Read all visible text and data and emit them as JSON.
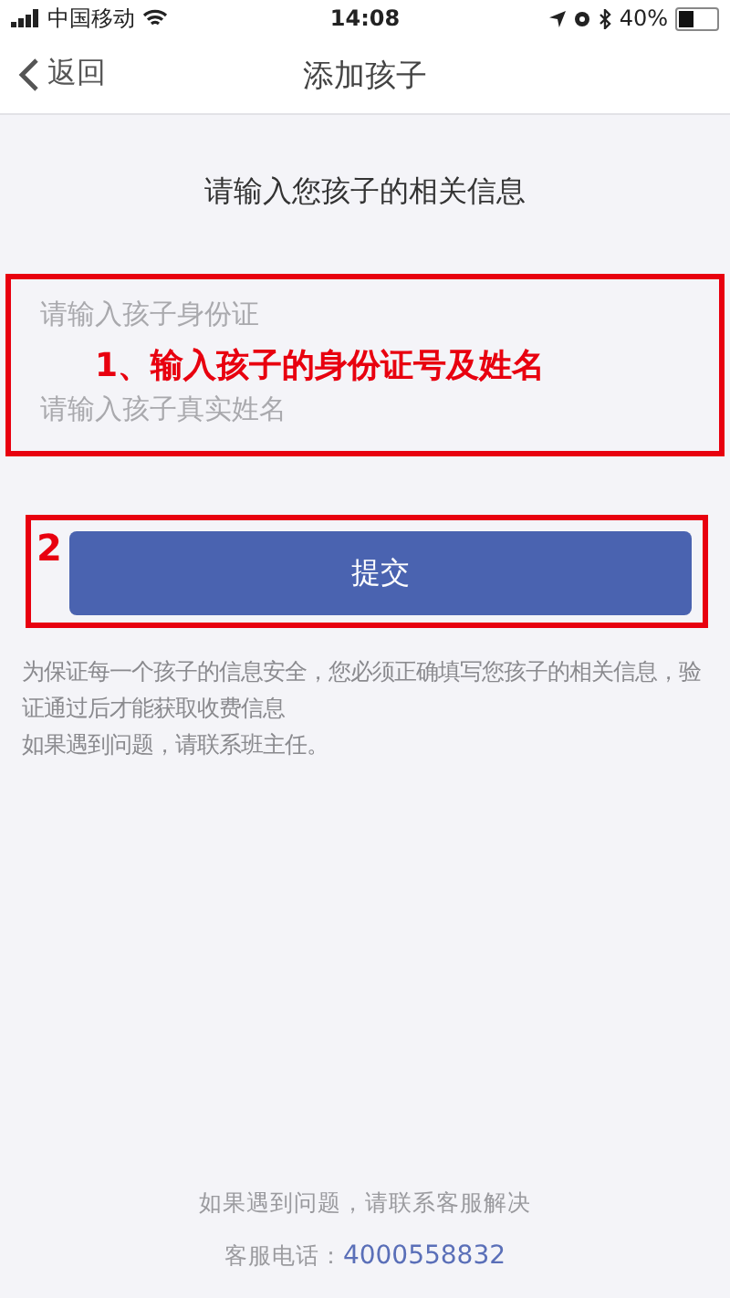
{
  "status_bar": {
    "carrier": "中国移动",
    "time": "14:08",
    "battery": "40%"
  },
  "nav": {
    "back": "返回",
    "title": "添加孩子"
  },
  "heading": "请输入您孩子的相关信息",
  "fields": [
    {
      "placeholder": "请输入孩子身份证"
    },
    {
      "placeholder": "请输入孩子真实姓名"
    }
  ],
  "fields_annotation": "1、输入孩子的身份证号及姓名",
  "submit": "提交",
  "submit_annotation": "2",
  "notes": [
    "为保证每一个孩子的信息安全，您必须正确填写您孩子的相关信息，验证通过后才能获取收费信息",
    "如果遇到问题，请联系班主任。"
  ],
  "footer": {
    "help": "如果遇到问题，请联系客服解决",
    "phone_label": "客服电话：",
    "phone": "4000558832"
  }
}
